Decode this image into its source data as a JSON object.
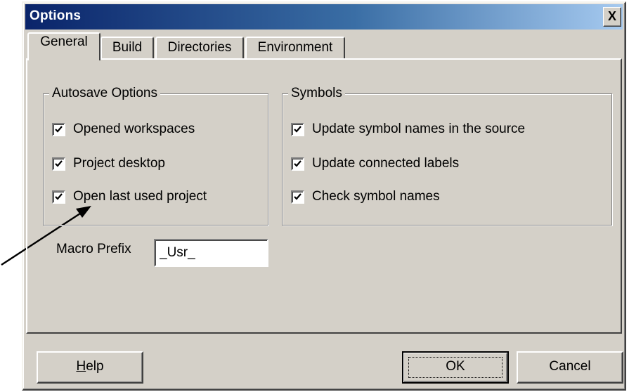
{
  "window": {
    "title": "Options",
    "close_label": "X"
  },
  "tabs": [
    {
      "label": "General",
      "active": true
    },
    {
      "label": "Build",
      "active": false
    },
    {
      "label": "Directories",
      "active": false
    },
    {
      "label": "Environment",
      "active": false
    }
  ],
  "autosave": {
    "title": "Autosave Options",
    "items": [
      {
        "label": "Opened workspaces",
        "checked": true
      },
      {
        "label": "Project desktop",
        "checked": true
      },
      {
        "label": "Open last used project",
        "checked": true
      }
    ]
  },
  "symbols": {
    "title": "Symbols",
    "items": [
      {
        "label": "Update symbol names in the source",
        "checked": true
      },
      {
        "label": "Update connected labels",
        "checked": true
      },
      {
        "label": "Check symbol names",
        "checked": true
      }
    ]
  },
  "macro": {
    "label": "Macro Prefix",
    "value": "_Usr_"
  },
  "buttons": {
    "help_first": "H",
    "help_rest": "elp",
    "ok": "OK",
    "cancel": "Cancel"
  },
  "icons": {
    "check": "check-icon",
    "close": "close-icon",
    "pointer": "arrow-pointer-icon"
  }
}
